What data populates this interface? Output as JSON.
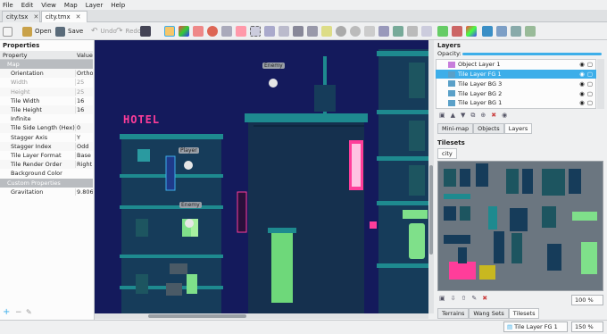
{
  "menu": [
    "File",
    "Edit",
    "View",
    "Map",
    "Layer",
    "Help"
  ],
  "tabs": [
    {
      "label": "city.tsx",
      "active": false
    },
    {
      "label": "city.tmx",
      "active": true
    }
  ],
  "toolbar": {
    "open_label": "Open",
    "save_label": "Save",
    "undo_label": "Undo",
    "redo_label": "Redo"
  },
  "properties": {
    "title": "Properties",
    "col_property": "Property",
    "col_value": "Value",
    "rows": [
      {
        "key": "Map",
        "value": "",
        "type": "group"
      },
      {
        "key": "Orientation",
        "value": "Ortho",
        "type": "row"
      },
      {
        "key": "Width",
        "value": "25",
        "type": "dim"
      },
      {
        "key": "Height",
        "value": "25",
        "type": "dim"
      },
      {
        "key": "Tile Width",
        "value": "16",
        "type": "row"
      },
      {
        "key": "Tile Height",
        "value": "16",
        "type": "row"
      },
      {
        "key": "Infinite",
        "value": "",
        "type": "row"
      },
      {
        "key": "Tile Side Length (Hex)",
        "value": "0",
        "type": "row"
      },
      {
        "key": "Stagger Axis",
        "value": "Y",
        "type": "row"
      },
      {
        "key": "Stagger Index",
        "value": "Odd",
        "type": "row"
      },
      {
        "key": "Tile Layer Format",
        "value": "Base",
        "type": "row"
      },
      {
        "key": "Tile Render Order",
        "value": "Right",
        "type": "row"
      },
      {
        "key": "Background Color",
        "value": "",
        "type": "row"
      },
      {
        "key": "Custom Properties",
        "value": "",
        "type": "group"
      },
      {
        "key": "Gravitation",
        "value": "9.806",
        "type": "row"
      }
    ]
  },
  "canvas": {
    "hotel_sign": "HOTEL",
    "markers": [
      "Enemy",
      "Player",
      "Enemy"
    ]
  },
  "layers": {
    "title": "Layers",
    "opacity_label": "Opacity:",
    "items": [
      {
        "name": "Object Layer 1",
        "selected": false
      },
      {
        "name": "Tile Layer FG 1",
        "selected": true
      },
      {
        "name": "Tile Layer BG 3",
        "selected": false
      },
      {
        "name": "Tile Layer BG 2",
        "selected": false
      },
      {
        "name": "Tile Layer BG 1",
        "selected": false
      }
    ],
    "tabs": [
      "Mini-map",
      "Objects",
      "Layers"
    ]
  },
  "tilesets": {
    "title": "Tilesets",
    "tab": "city",
    "zoom": "100 %",
    "bottom_tabs": [
      "Terrains",
      "Wang Sets",
      "Tilesets"
    ]
  },
  "status": {
    "layer": "Tile Layer FG 1",
    "zoom": "150 %"
  },
  "colors": {
    "accent": "#3daee9",
    "canvas_bg": "#141a5c",
    "building": "#1e6f78",
    "neon_pink": "#ff3d9a",
    "window_green": "#7fe08a"
  }
}
